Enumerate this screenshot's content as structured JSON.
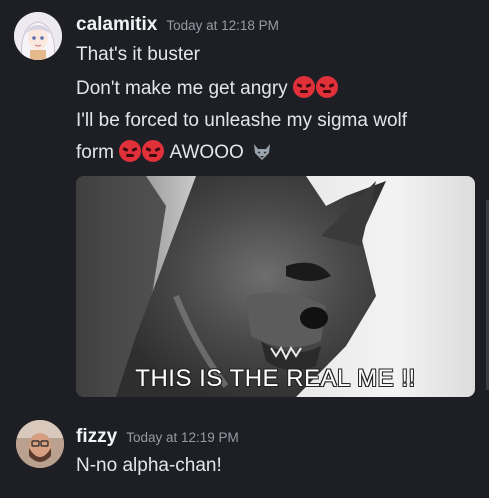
{
  "messages": [
    {
      "username": "calamitix",
      "timestamp": "Today at 12:18 PM",
      "lines": [
        "That's it buster",
        "Don't make me get angry",
        "I'll be forced to unleashe my sigma wolf",
        "form",
        "AWOOO"
      ],
      "emojis": [
        "angry-face-icon",
        "angry-face-icon",
        "angry-face-icon",
        "angry-face-icon",
        "wolf-icon"
      ],
      "gif_caption": "THIS IS THE REAL ME !!"
    },
    {
      "username": "fizzy",
      "timestamp": "Today at 12:19 PM",
      "lines": [
        "N-no alpha-chan!"
      ]
    }
  ],
  "colors": {
    "background": "#1e1f25",
    "username": "#f2f3f5",
    "timestamp": "#949ba4",
    "text": "#e3e5e8",
    "angry_emoji": "#e0303a"
  }
}
